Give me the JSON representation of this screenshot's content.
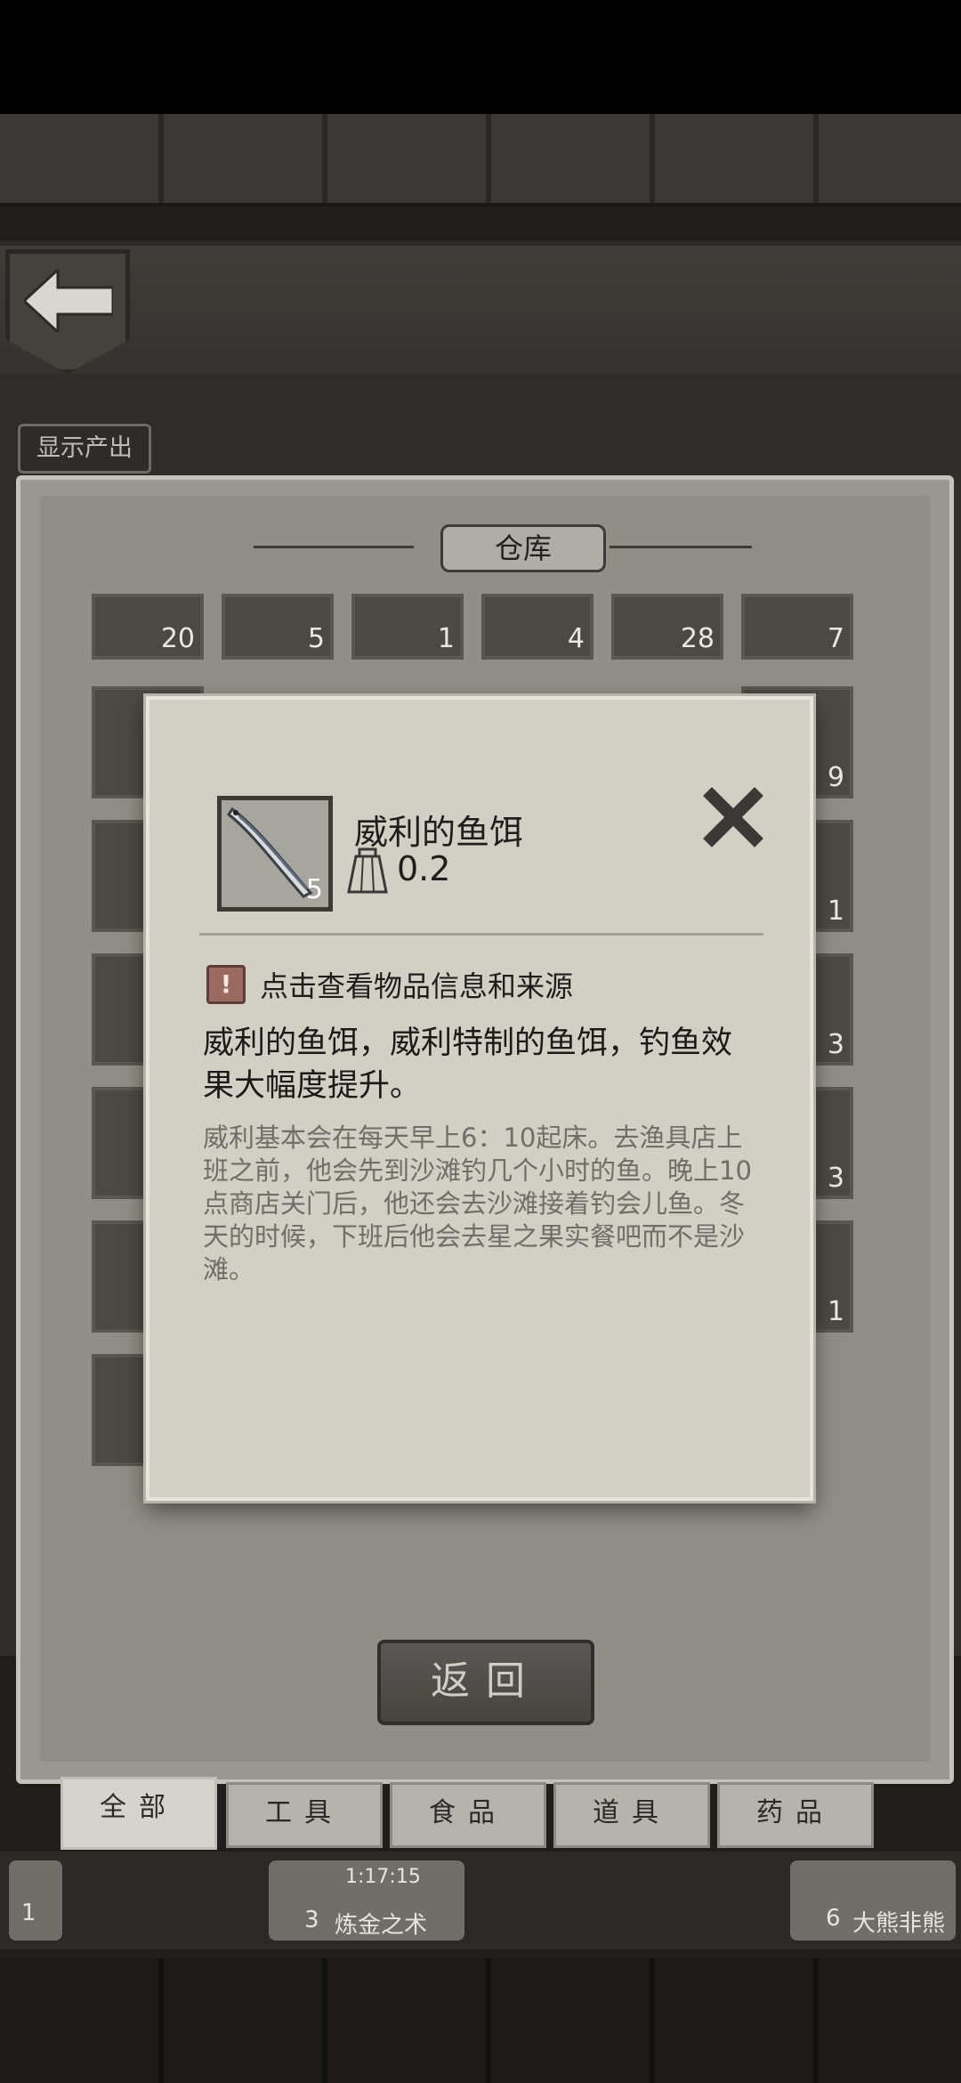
{
  "header": {
    "show_output_label": "显示产出"
  },
  "warehouse": {
    "title": "仓库",
    "top_row_counts": [
      "20",
      "5",
      "1",
      "4",
      "28",
      "7"
    ],
    "right_column_counts": [
      "9",
      "1",
      "3",
      "3",
      "1"
    ]
  },
  "tabs": [
    {
      "label": "全部",
      "active": true
    },
    {
      "label": "工具",
      "active": false
    },
    {
      "label": "食品",
      "active": false
    },
    {
      "label": "道具",
      "active": false
    },
    {
      "label": "药品",
      "active": false
    }
  ],
  "bottom_bar": {
    "left_badge": "1",
    "center_timer": "1:17:15",
    "center_badge": "3",
    "center_label": "炼金之术",
    "right_badge": "6",
    "right_label": "大熊非熊"
  },
  "return_button_label": "返回",
  "item_popup": {
    "icon_name": "fishing-bait-icon",
    "count": "5",
    "name": "威利的鱼饵",
    "weight": "0.2",
    "info_hint": "点击查看物品信息和来源",
    "description": "威利的鱼饵，威利特制的鱼饵，钓鱼效果大幅度提升。",
    "lore": "威利基本会在每天早上6：10起床。去渔具店上班之前，他会先到沙滩钓几个小时的鱼。晚上10点商店关门后，他还会去沙滩接着钓会儿鱼。冬天的时候，下班后他会去星之果实餐吧而不是沙滩。"
  }
}
